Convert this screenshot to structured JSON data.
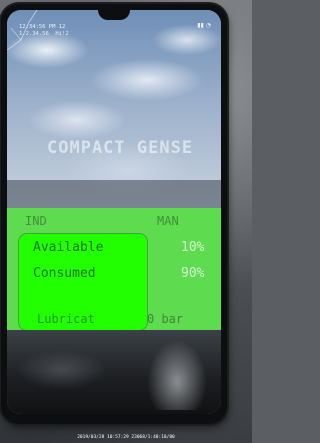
{
  "status_bar": {
    "text": "12:34:56 PM 12\n1.2.34.56  Hi!2"
  },
  "screen": {
    "title": "COMPACT GENSE",
    "columns": [
      "IND",
      "MAN"
    ],
    "rows": [
      {
        "label": "Available",
        "value": "10%"
      },
      {
        "label": "Consumed",
        "value": "90%"
      }
    ],
    "bottom_row": {
      "label": "Lubricat",
      "value": "0 bar"
    }
  },
  "timestamp": "2019/03/28 10:57:29 23068/1:40:18/80"
}
